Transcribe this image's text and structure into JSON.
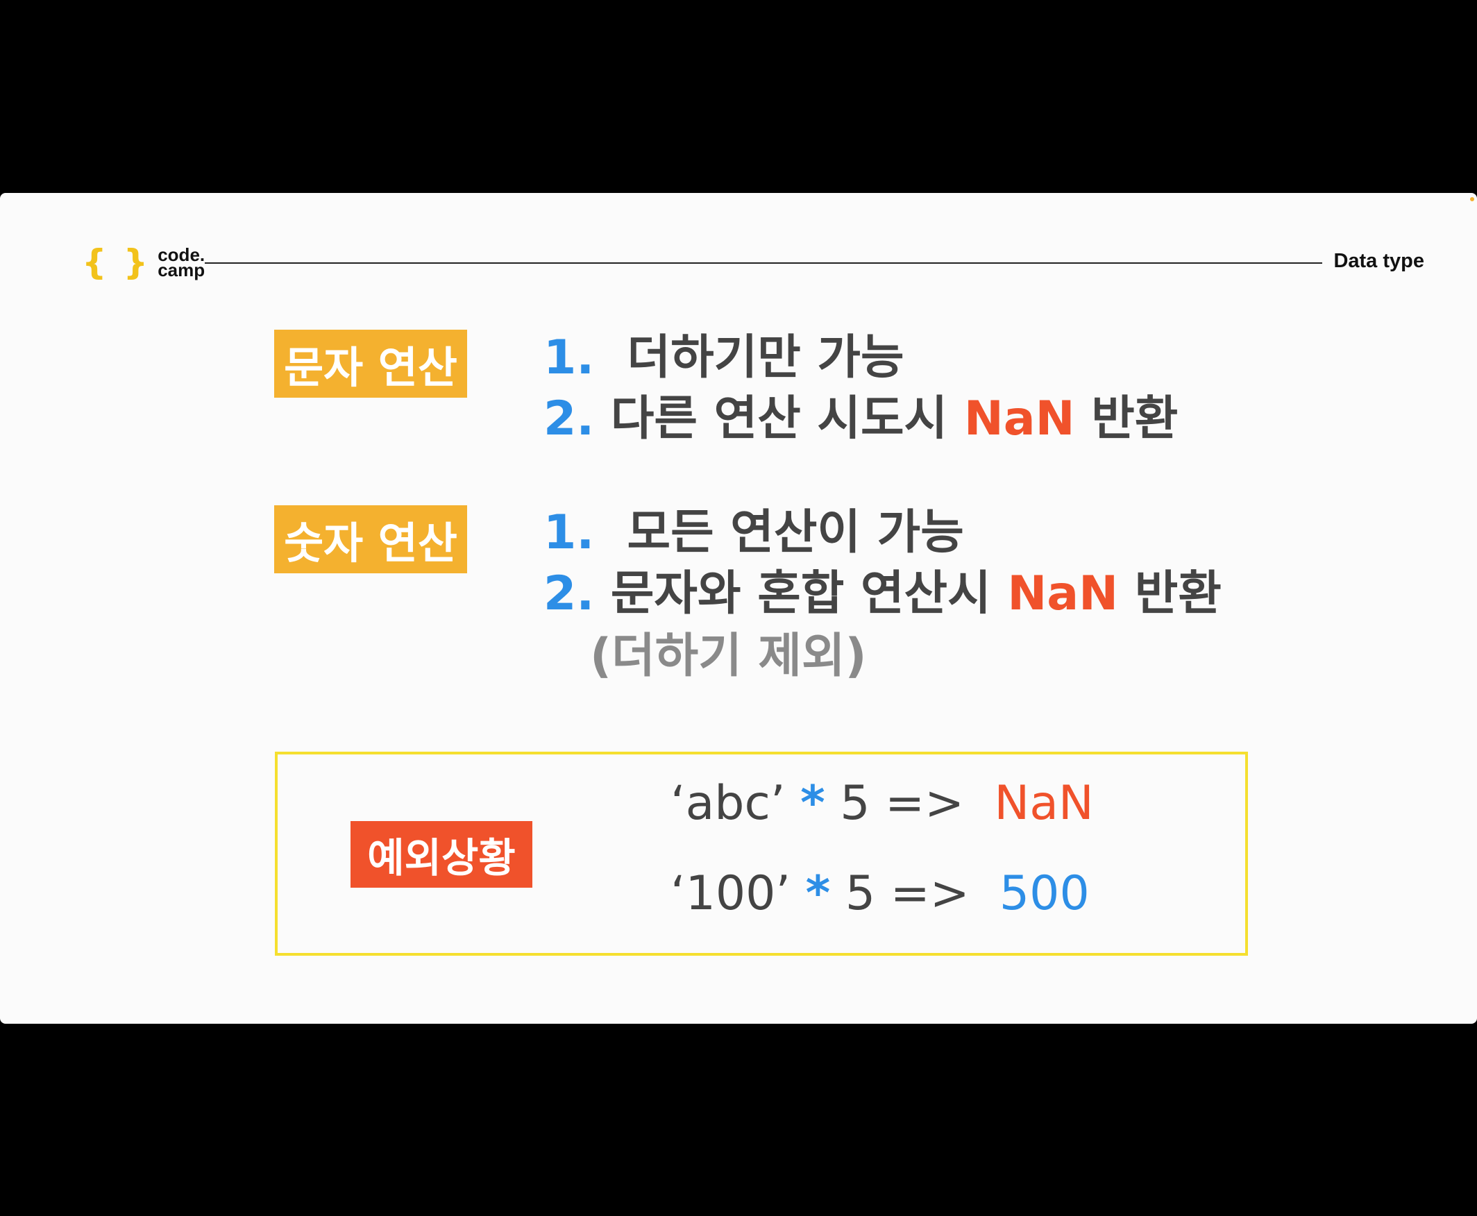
{
  "header": {
    "logo_brace_open": "{",
    "logo_brace_close": "}",
    "logo_line1": "code.",
    "logo_line2": "camp",
    "title": "Data type"
  },
  "string_ops": {
    "tag": "문자 연산",
    "item1_num": "1.",
    "item1_text": "더하기만 가능",
    "item2_num": "2.",
    "item2_text_before": "다른 연산 시도시",
    "item2_highlight": "NaN",
    "item2_text_after": "반환"
  },
  "number_ops": {
    "tag": "숫자 연산",
    "item1_num": "1.",
    "item1_text": "모든 연산이 가능",
    "item2_num": "2.",
    "item2_text_before": "문자와 혼합 연산시",
    "item2_highlight": "NaN",
    "item2_text_after": "반환",
    "item2_note": "(더하기 제외)"
  },
  "exception": {
    "tag": "예외상황",
    "ex1_operand": "‘abc’",
    "ex1_operator": "*",
    "ex1_rest": "5  =>",
    "ex1_result": "NaN",
    "ex2_operand": "‘100’",
    "ex2_operator": "*",
    "ex2_rest": "5  =>",
    "ex2_result": "500"
  },
  "colors": {
    "accent_yellow": "#f4b12f",
    "accent_red": "#f0522b",
    "number_blue": "#2d8ee6",
    "box_border": "#f5df2f"
  }
}
